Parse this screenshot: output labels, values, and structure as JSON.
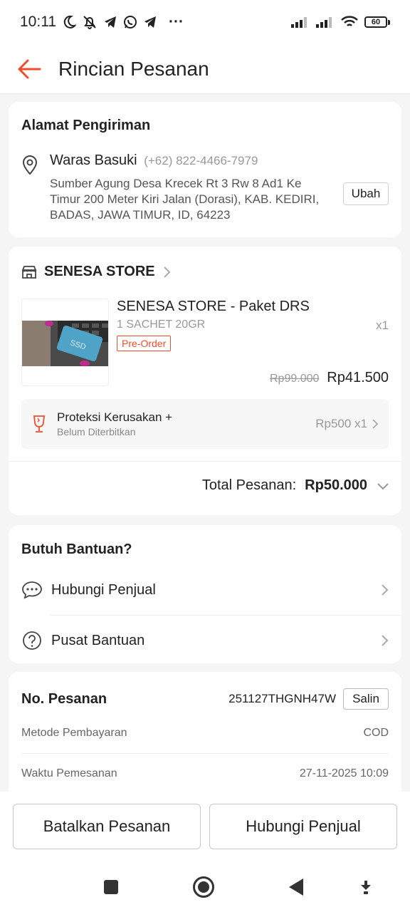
{
  "status_bar": {
    "time": "10:11",
    "battery": "60",
    "more_glyph": "···",
    "icons": [
      "moon-icon",
      "bell-off-icon",
      "telegram-icon",
      "whatsapp-icon",
      "telegram-icon",
      "signal-icon",
      "signal-icon",
      "wifi-icon",
      "battery-icon"
    ]
  },
  "header": {
    "title": "Rincian Pesanan",
    "back_icon": "arrow-left-icon",
    "accent": "#ee4d2d"
  },
  "address": {
    "section_title": "Alamat Pengiriman",
    "name": "Waras Basuki",
    "phone": "(+62) 822-4466-7979",
    "detail": "Sumber Agung Desa Krecek Rt 3 Rw 8 Ad1 Ke Timur 200 Meter Kiri Jalan (Dorasi), KAB. KEDIRI, BADAS, JAWA TIMUR, ID, 64223",
    "change_button": "Ubah"
  },
  "shop": {
    "name": "SENESA STORE",
    "product": {
      "title": "SENESA STORE - Paket DRS",
      "variant": "1 SACHET 20GR",
      "qty": "x1",
      "tag": "Pre-Order",
      "image_label": "SSD",
      "price_original": "Rp99.000",
      "price_final": "Rp41.500"
    },
    "protection": {
      "title": "Proteksi Kerusakan +",
      "subtitle": "Belum Diterbitkan",
      "price": "Rp500 x1"
    },
    "total_label": "Total Pesanan:",
    "total_value": "Rp50.000"
  },
  "help": {
    "title": "Butuh Bantuan?",
    "items": [
      {
        "label": "Hubungi Penjual",
        "icon": "chat-icon"
      },
      {
        "label": "Pusat Bantuan",
        "icon": "question-icon"
      }
    ]
  },
  "order": {
    "no_label": "No. Pesanan",
    "no_value": "251127THGNH47W",
    "copy_button": "Salin",
    "rows": [
      {
        "key": "Metode Pembayaran",
        "value": "COD"
      },
      {
        "key": "Waktu Pemesanan",
        "value": "27-11-2025 10:09"
      }
    ]
  },
  "actions": {
    "cancel": "Batalkan Pesanan",
    "contact": "Hubungi Penjual"
  },
  "nav": {
    "icons": [
      "recents-square-icon",
      "home-circle-icon",
      "back-triangle-icon",
      "download-arrow-icon"
    ]
  }
}
